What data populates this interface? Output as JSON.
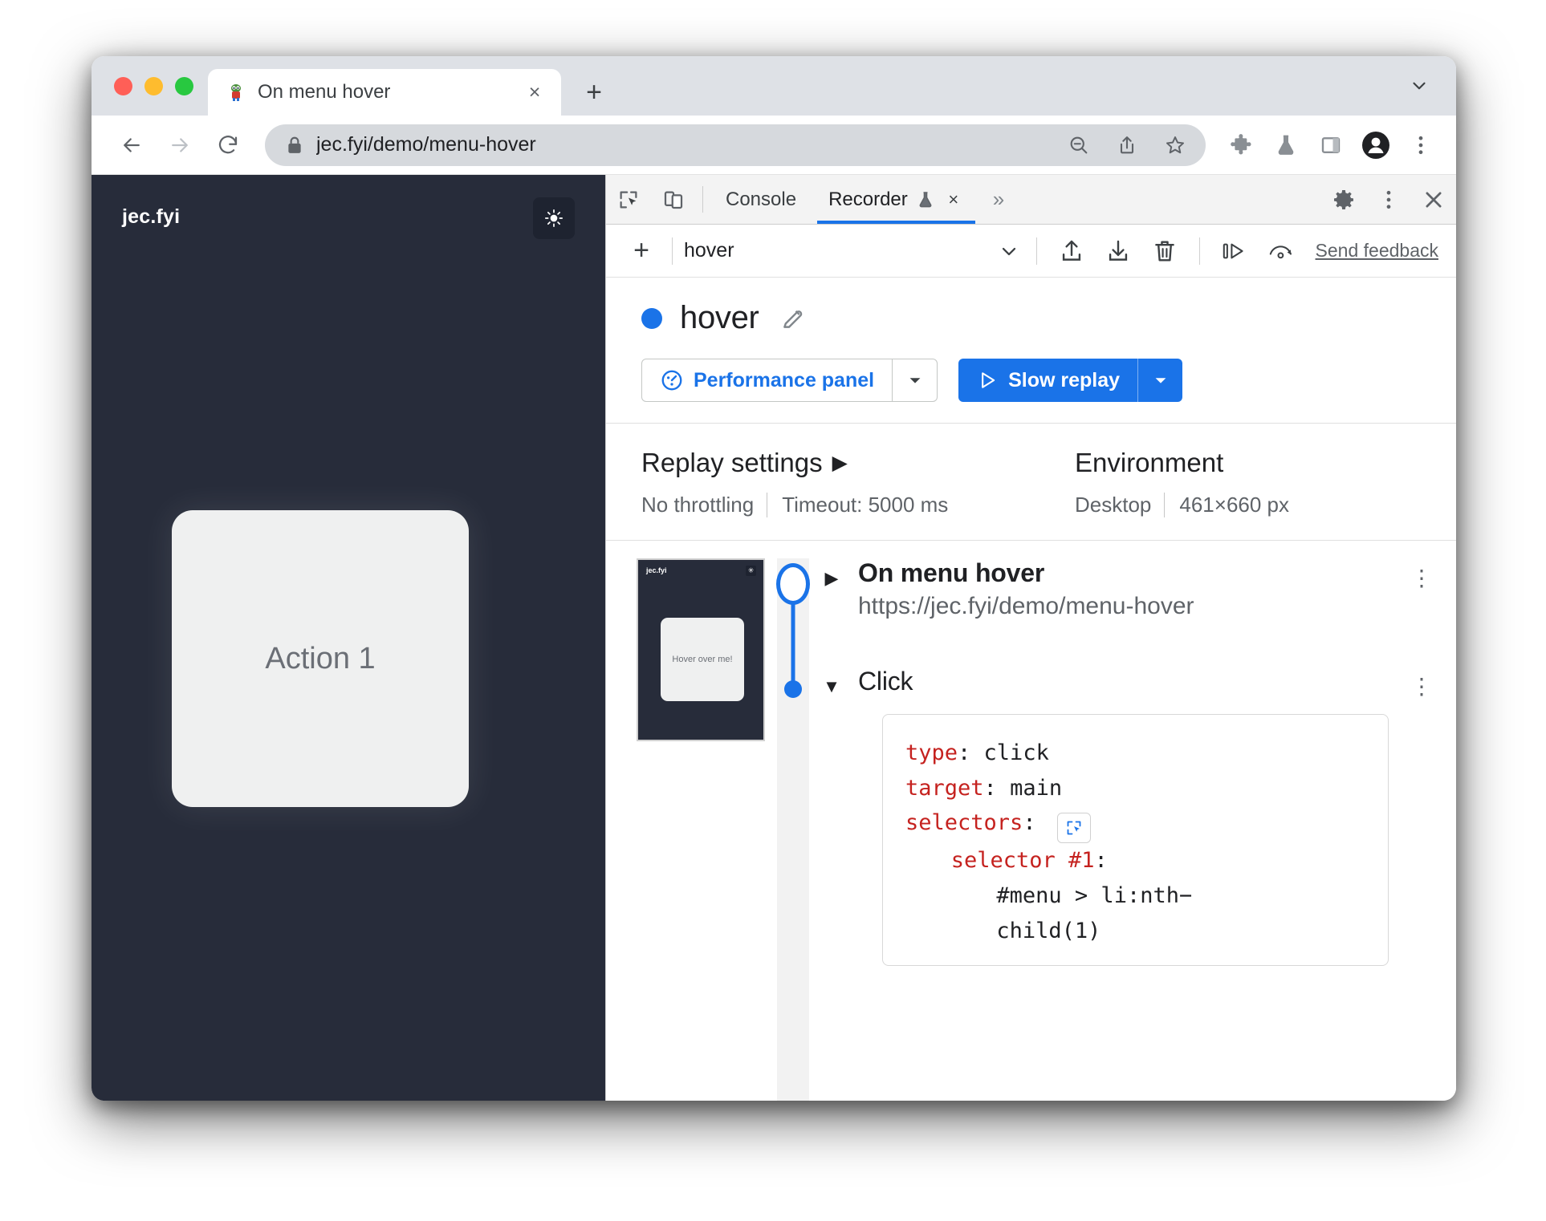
{
  "browser": {
    "tab": {
      "title": "On menu hover",
      "favicon": "bug-favicon",
      "close_label": "×"
    },
    "new_tab_label": "+",
    "omnibox": {
      "url": "jec.fyi/demo/menu-hover",
      "lock": "lock-icon"
    },
    "nav": {
      "back": "←",
      "forward": "→",
      "reload": "⟳"
    }
  },
  "page": {
    "brand": "jec.fyi",
    "theme_toggle": "sun-icon",
    "card_label": "Action 1"
  },
  "devtools": {
    "tabs": [
      {
        "label": "Console",
        "active": false
      },
      {
        "label": "Recorder",
        "active": true,
        "experiment_icon": "flask-icon",
        "close": "×"
      }
    ],
    "more_tabs": "»",
    "right_icons": [
      "gear-icon",
      "kebab-icon",
      "close-icon"
    ]
  },
  "recorder": {
    "toolbar": {
      "add_label": "+",
      "selected_recording": "hover",
      "dropdown": "chevron-down-icon",
      "icons": [
        "import-icon",
        "export-icon",
        "delete-icon",
        "step-over-icon",
        "replay-icon"
      ],
      "feedback_label": "Send feedback"
    },
    "title": "hover",
    "edit_icon": "pencil-icon",
    "buttons": {
      "performance_label": "Performance panel",
      "performance_icon": "performance-icon",
      "replay_label": "Slow replay",
      "replay_icon": "play-icon"
    },
    "replay_settings": {
      "heading": "Replay settings",
      "caret": "▶",
      "throttling": "No throttling",
      "timeout": "Timeout: 5000 ms"
    },
    "environment": {
      "heading": "Environment",
      "device": "Desktop",
      "viewport": "461×660 px"
    },
    "thumbnail": {
      "brand": "jec.fyi",
      "toggle": "sun-icon",
      "card_label": "Hover over me!"
    },
    "steps": [
      {
        "caret": "▶",
        "title": "On menu hover",
        "url": "https://jec.fyi/demo/menu-hover",
        "kebab": "⋮"
      },
      {
        "caret": "▼",
        "title": "Click",
        "kebab": "⋮",
        "code": {
          "type_key": "type",
          "type_value": "click",
          "target_key": "target",
          "target_value": "main",
          "selectors_key": "selectors",
          "selector_picker_icon": "selector-picker-icon",
          "selector_1_key": "selector #1",
          "selector_1_value_line1": "#menu > li:nth−",
          "selector_1_value_line2": "child(1)"
        }
      }
    ]
  },
  "colors": {
    "accent": "#1a73e8",
    "page_bg": "#272c3a",
    "code_key": "#c5221f",
    "tabstrip": "#dee1e6"
  }
}
